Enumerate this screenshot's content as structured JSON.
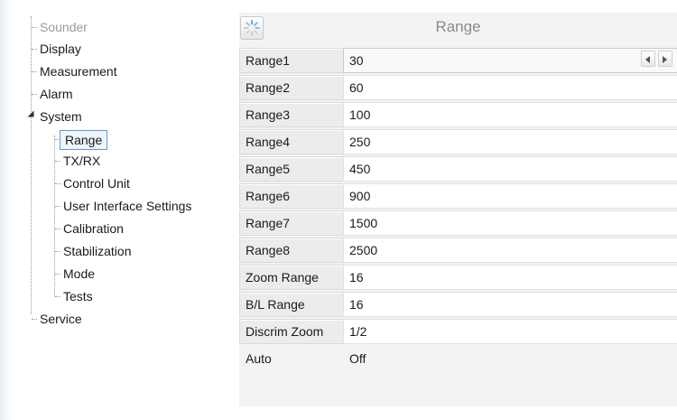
{
  "tree": {
    "items": [
      {
        "label": "Sounder",
        "level": 0
      },
      {
        "label": "Display",
        "level": 0
      },
      {
        "label": "Measurement",
        "level": 0
      },
      {
        "label": "Alarm",
        "level": 0
      },
      {
        "label": "System",
        "level": 0,
        "expanded": true
      },
      {
        "label": "Range",
        "level": 1,
        "selected": true
      },
      {
        "label": "TX/RX",
        "level": 1
      },
      {
        "label": "Control Unit",
        "level": 1
      },
      {
        "label": "User Interface Settings",
        "level": 1
      },
      {
        "label": "Calibration",
        "level": 1
      },
      {
        "label": "Stabilization",
        "level": 1
      },
      {
        "label": "Mode",
        "level": 1
      },
      {
        "label": "Tests",
        "level": 1
      },
      {
        "label": "Service",
        "level": 0
      }
    ]
  },
  "panel": {
    "title": "Range",
    "icon": "loading-spinner-icon",
    "rows": [
      {
        "label": "Range1",
        "value": "30"
      },
      {
        "label": "Range2",
        "value": "60"
      },
      {
        "label": "Range3",
        "value": "100"
      },
      {
        "label": "Range4",
        "value": "250"
      },
      {
        "label": "Range5",
        "value": "450"
      },
      {
        "label": "Range6",
        "value": "900"
      },
      {
        "label": "Range7",
        "value": "1500"
      },
      {
        "label": "Range8",
        "value": "2500"
      },
      {
        "label": "Zoom Range",
        "value": "16"
      },
      {
        "label": "B/L Range",
        "value": "16"
      },
      {
        "label": "Discrim Zoom",
        "value": "1/2"
      },
      {
        "label": "Auto",
        "value": "Off"
      }
    ]
  },
  "colors": {
    "selection_border": "#5e9bd4",
    "selection_fill": "#eef5fc",
    "panel_bg": "#f3f3f3"
  }
}
